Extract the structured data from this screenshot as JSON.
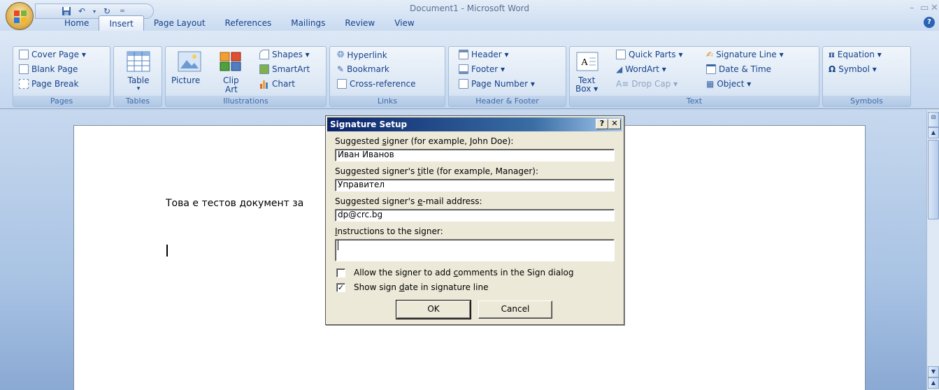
{
  "window": {
    "title": "Document1 - Microsoft Word",
    "minimize": "–",
    "restore": "▭",
    "close": "✕"
  },
  "qat": {
    "icons": [
      "save-icon",
      "undo-icon",
      "redo-icon",
      "customize-icon"
    ]
  },
  "tabs": [
    "Home",
    "Insert",
    "Page Layout",
    "References",
    "Mailings",
    "Review",
    "View"
  ],
  "active_tab": "Insert",
  "ribbon": {
    "pages": {
      "label": "Pages",
      "cover_page": "Cover Page ▾",
      "blank_page": "Blank Page",
      "page_break": "Page Break"
    },
    "tables": {
      "label": "Tables",
      "table": "Table",
      "arrow": "▾"
    },
    "illustrations": {
      "label": "Illustrations",
      "picture": "Picture",
      "clip_art_1": "Clip",
      "clip_art_2": "Art",
      "shapes": "Shapes ▾",
      "smartart": "SmartArt",
      "chart": "Chart"
    },
    "links": {
      "label": "Links",
      "hyperlink": "Hyperlink",
      "bookmark": "Bookmark",
      "cross_reference": "Cross-reference"
    },
    "header_footer": {
      "label": "Header & Footer",
      "header": "Header ▾",
      "footer": "Footer ▾",
      "page_number": "Page Number ▾"
    },
    "text": {
      "label": "Text",
      "text_box_1": "Text",
      "text_box_2": "Box ▾",
      "quick_parts": "Quick Parts ▾",
      "wordart": "WordArt ▾",
      "drop_cap": "Drop Cap ▾",
      "signature_line": "Signature Line ▾",
      "date_time": "Date & Time",
      "object": "Object ▾"
    },
    "symbols": {
      "label": "Symbols",
      "equation": "Equation ▾",
      "symbol": "Symbol ▾"
    }
  },
  "document": {
    "text": "Това е тестов документ за"
  },
  "dialog": {
    "title": "Signature Setup",
    "help_btn": "?",
    "close_btn": "✕",
    "signer_label": "Suggested signer (for example, John Doe):",
    "signer_value": "Иван Иванов",
    "title_label": "Suggested signer's title (for example, Manager):",
    "title_value": "Управител",
    "email_label": "Suggested signer's e-mail address:",
    "email_value": "dp@crc.bg",
    "instructions_label": "Instructions to the signer:",
    "instructions_value": "",
    "allow_comments_label": "Allow the signer to add comments in the Sign dialog",
    "allow_comments_checked": false,
    "show_date_label": "Show sign date in signature line",
    "show_date_checked": true,
    "ok": "OK",
    "cancel": "Cancel"
  }
}
